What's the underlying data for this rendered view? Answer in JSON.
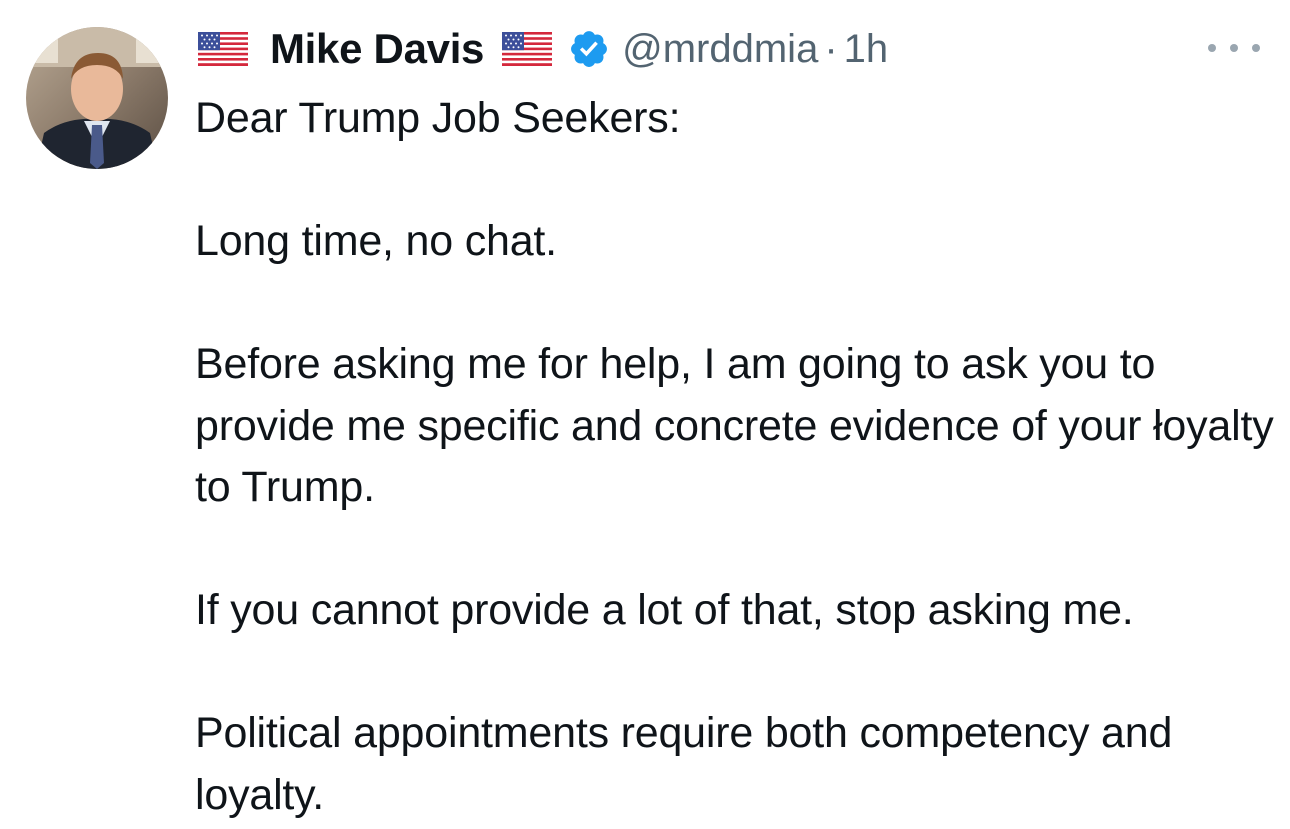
{
  "tweet": {
    "author": {
      "display_name": "Mike Davis",
      "handle": "@mrddmia",
      "verified": true,
      "flag_emoji": "🇺🇸"
    },
    "separator": "·",
    "time": "1h",
    "more_icon": "more-horizontal-icon",
    "paragraphs": [
      "Dear Trump Job Seekers:",
      "Long time, no chat.",
      "Before asking me for help, I am going to ask you to provide me specific and concrete evidence of your łoyalty to Trump.",
      "If you cannot provide a lot of that, stop asking me.",
      "Political appointments require both competency and loyalty."
    ]
  },
  "colors": {
    "text_primary": "#0f1419",
    "text_secondary": "#536471",
    "verified_blue": "#1d9bf0",
    "background": "#ffffff"
  }
}
